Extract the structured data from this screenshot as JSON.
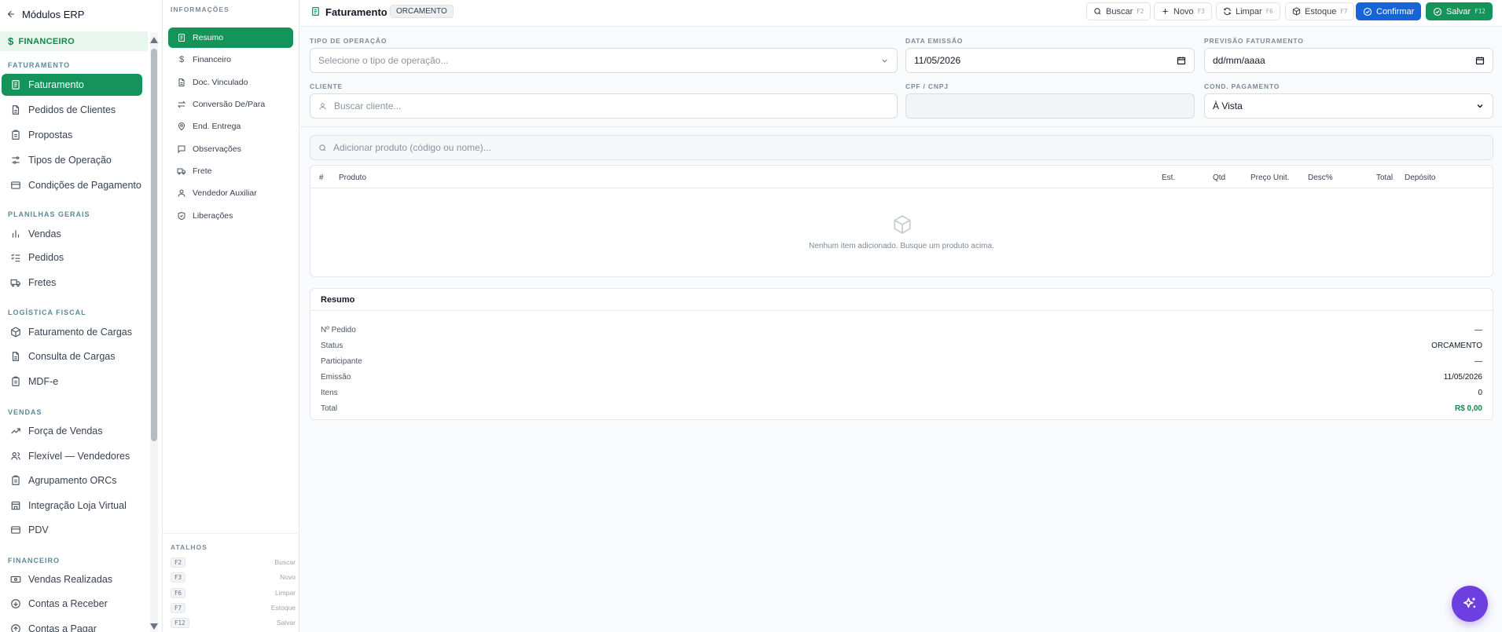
{
  "sidebar": {
    "back_label": "Módulos ERP",
    "section": "FINANCEIRO",
    "groups": [
      {
        "title": "FATURAMENTO",
        "items": [
          "Faturamento",
          "Pedidos de Clientes",
          "Propostas",
          "Tipos de Operação",
          "Condições de Pagamento"
        ]
      },
      {
        "title": "PLANILHAS GERAIS",
        "items": [
          "Vendas",
          "Pedidos",
          "Fretes"
        ]
      },
      {
        "title": "LOGÍSTICA FISCAL",
        "items": [
          "Faturamento de Cargas",
          "Consulta de Cargas",
          "MDF-e"
        ]
      },
      {
        "title": "VENDAS",
        "items": [
          "Força de Vendas",
          "Flexível — Vendedores",
          "Agrupamento ORCs",
          "Integração Loja Virtual",
          "PDV"
        ]
      },
      {
        "title": "FINANCEIRO",
        "items": [
          "Vendas Realizadas",
          "Contas a Receber",
          "Contas a Pagar"
        ]
      }
    ]
  },
  "subnav": {
    "title": "INFORMAÇÕES",
    "items": [
      "Resumo",
      "Financeiro",
      "Doc. Vinculado",
      "Conversão De/Para",
      "End. Entrega",
      "Observações",
      "Frete",
      "Vendedor Auxiliar",
      "Liberações"
    ],
    "shortcuts_title": "ATALHOS",
    "shortcuts": [
      {
        "key": "F2",
        "label": "Buscar"
      },
      {
        "key": "F3",
        "label": "Novo"
      },
      {
        "key": "F6",
        "label": "Limpar"
      },
      {
        "key": "F7",
        "label": "Estoque"
      },
      {
        "key": "F12",
        "label": "Salvar"
      }
    ]
  },
  "topbar": {
    "title": "Faturamento",
    "badge": "ORCAMENTO",
    "buttons": {
      "buscar": {
        "label": "Buscar",
        "key": "F2"
      },
      "novo": {
        "label": "Novo",
        "key": "F3"
      },
      "limpar": {
        "label": "Limpar",
        "key": "F6"
      },
      "estoque": {
        "label": "Estoque",
        "key": "F7"
      },
      "confirmar": {
        "label": "Confirmar"
      },
      "salvar": {
        "label": "Salvar",
        "key": "F12"
      }
    }
  },
  "form": {
    "tipo_operacao": {
      "label": "TIPO DE OPERAÇÃO",
      "placeholder": "Selecione o tipo de operação..."
    },
    "data_emissao": {
      "label": "DATA EMISSÃO",
      "value": "11/05/2026"
    },
    "previsao": {
      "label": "PREVISÃO FATURAMENTO",
      "value": "dd/mm/aaaa"
    },
    "cliente": {
      "label": "CLIENTE",
      "placeholder": "Buscar cliente..."
    },
    "cpf": {
      "label": "CPF / CNPJ",
      "value": ""
    },
    "cond_pagamento": {
      "label": "COND. PAGAMENTO",
      "value": "À Vista"
    }
  },
  "items": {
    "search_placeholder": "Adicionar produto (código ou nome)...",
    "columns": {
      "num": "#",
      "produto": "Produto",
      "est": "Est.",
      "qtd": "Qtd",
      "preco": "Preço Unit.",
      "desc": "Desc%",
      "total": "Total",
      "deposito": "Depósito"
    },
    "empty_message": "Nenhum item adicionado. Busque um produto acima."
  },
  "summary": {
    "title": "Resumo",
    "rows": [
      {
        "label": "Nº Pedido",
        "value": "—"
      },
      {
        "label": "Status",
        "value": "ORCAMENTO"
      },
      {
        "label": "Participante",
        "value": "—"
      },
      {
        "label": "Emissão",
        "value": "11/05/2026"
      },
      {
        "label": "Itens",
        "value": "0"
      },
      {
        "label": "Total",
        "value": "R$ 0,00"
      }
    ]
  },
  "colors": {
    "brand_green": "#14935a",
    "confirm_blue": "#1565d8",
    "fab_purple": "#6d3fe0"
  }
}
